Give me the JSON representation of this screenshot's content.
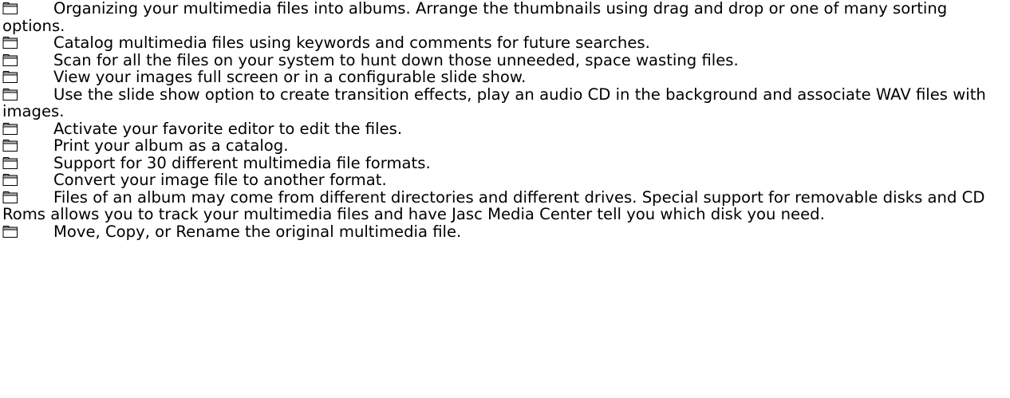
{
  "bullet_icon": "folder-icon",
  "items": [
    "Organizing your multimedia files into albums. Arrange the thumbnails using drag and drop or one of many sorting options.",
    "Catalog multimedia files using keywords and comments for future searches.",
    "Scan for all the files on your system to hunt down those unneeded, space wasting files.",
    "View your images full screen or in a configurable slide show.",
    "Use the slide show option to create transition effects, play an audio CD in the background and associate WAV files with images.",
    "Activate your favorite editor to edit the files.",
    "Print your album as a catalog.",
    "Support for 30 different multimedia file formats.",
    "Convert your image file to another format.",
    "Files of an album may come from different directories and different drives. Special support for removable disks and CD Roms allows you to track your multimedia files and have Jasc Media Center tell you which disk you need.",
    "Move, Copy, or Rename the original multimedia file."
  ]
}
